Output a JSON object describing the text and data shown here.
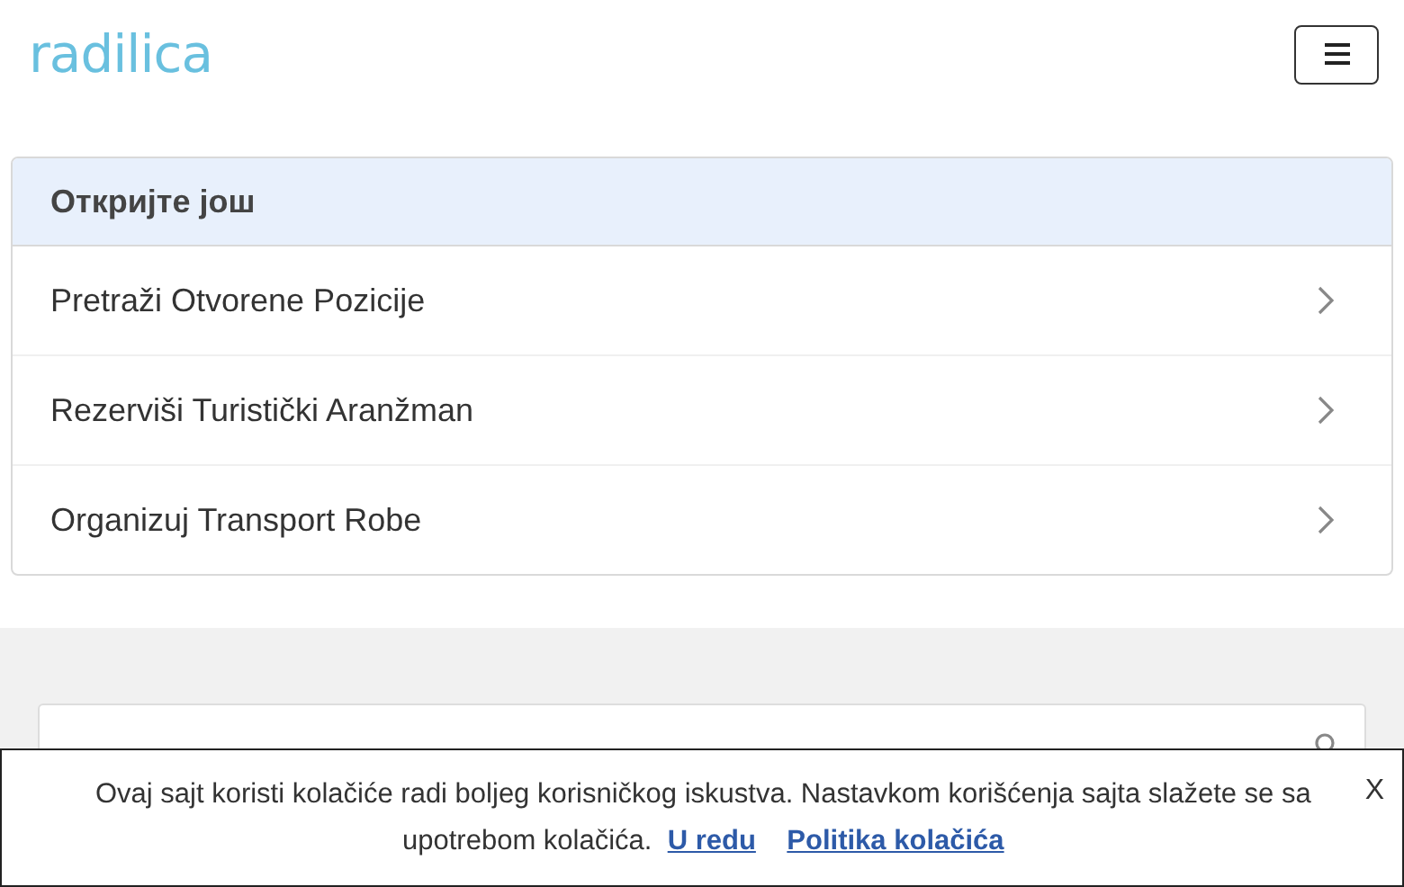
{
  "header": {
    "logo": "radilica"
  },
  "discover": {
    "title": "Откријте још",
    "items": [
      {
        "label": "Pretraži Otvorene Pozicije"
      },
      {
        "label": "Rezerviši Turistički Aranžman"
      },
      {
        "label": "Organizuj Transport Robe"
      }
    ]
  },
  "cookie_banner": {
    "text": "Ovaj sajt koristi kolačiće radi boljeg korisničkog iskustva. Nastavkom korišćenja sajta slažete se sa upotrebom kolačića.",
    "accept": "U redu",
    "policy": "Politika kolačića",
    "close": "X"
  }
}
